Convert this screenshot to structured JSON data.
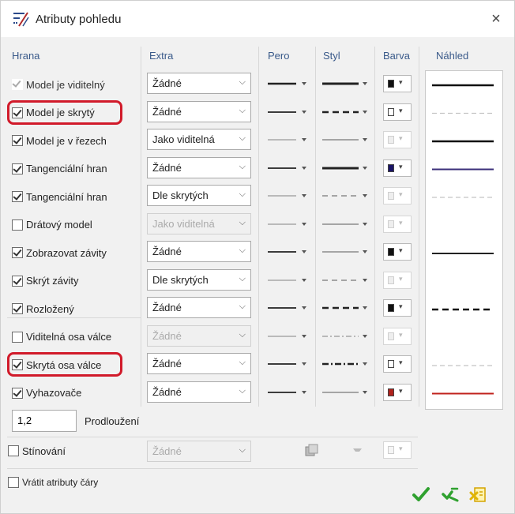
{
  "window": {
    "title": "Atributy pohledu",
    "close": "×"
  },
  "headers": {
    "hrana": "Hrana",
    "extra": "Extra",
    "pero": "Pero",
    "styl": "Styl",
    "barva": "Barva",
    "nahled": "Náhled"
  },
  "rows": [
    {
      "label": "Model je viditelný",
      "checked": true,
      "enabled": false,
      "extra": "Žádné",
      "extra_enabled": true,
      "pen": "thick",
      "style": "solid-thick",
      "color": "#111111",
      "preview": "solid-thick",
      "preview_color": "#111111"
    },
    {
      "label": "Model je skrytý",
      "checked": true,
      "enabled": true,
      "extra": "Žádné",
      "extra_enabled": true,
      "pen": "medium",
      "style": "dashed",
      "color": "#ffffff",
      "preview": "dashed-light",
      "preview_color": "#c4c4c4",
      "highlighted": true
    },
    {
      "label": "Model je v řezech",
      "checked": true,
      "enabled": true,
      "extra": "Jako viditelná",
      "extra_enabled": true,
      "pen": "light",
      "style": "solid-light",
      "color": "#eeeeee",
      "preview": "solid-thick",
      "preview_color": "#111111"
    },
    {
      "label": "Tangenciální hran",
      "checked": true,
      "enabled": true,
      "extra": "Žádné",
      "extra_enabled": true,
      "pen": "medium",
      "style": "solid-thick",
      "color": "#1a1466",
      "preview": "solid-medium",
      "preview_color": "#3b2f7a"
    },
    {
      "label": "Tangenciální hran",
      "checked": true,
      "enabled": true,
      "extra": "Dle skrytých",
      "extra_enabled": true,
      "pen": "light",
      "style": "dashed-light",
      "color": "#eeeeee",
      "preview": "dashed-light",
      "preview_color": "#c4c4c4"
    },
    {
      "label": "Drátový model",
      "checked": false,
      "enabled": true,
      "extra": "Jako viditelná",
      "extra_enabled": false,
      "pen": "light",
      "style": "solid-light",
      "color": "#eeeeee",
      "preview": "none",
      "preview_color": "#ffffff"
    },
    {
      "label": "Zobrazovat závity",
      "checked": true,
      "enabled": true,
      "extra": "Žádné",
      "extra_enabled": true,
      "pen": "medium",
      "style": "solid-light",
      "color": "#111111",
      "preview": "solid-medium",
      "preview_color": "#222222"
    },
    {
      "label": "Skrýt závity",
      "checked": true,
      "enabled": true,
      "extra": "Dle skrytých",
      "extra_enabled": true,
      "pen": "light",
      "style": "dashed-light",
      "color": "#eeeeee",
      "preview": "none",
      "preview_color": "#ffffff"
    },
    {
      "label": "Rozložený",
      "checked": true,
      "enabled": true,
      "extra": "Žádné",
      "extra_enabled": true,
      "pen": "medium",
      "style": "dashed",
      "color": "#111111",
      "preview": "dashed-thick",
      "preview_color": "#111111"
    },
    {
      "label": "Viditelná osa válce",
      "checked": false,
      "enabled": true,
      "extra": "Žádné",
      "extra_enabled": false,
      "pen": "light",
      "style": "dashdot-light",
      "color": "#eeeeee",
      "preview": "none",
      "preview_color": "#ffffff"
    },
    {
      "label": "Skrytá osa válce",
      "checked": true,
      "enabled": true,
      "extra": "Žádné",
      "extra_enabled": true,
      "pen": "medium",
      "style": "dashdot",
      "color": "#ffffff",
      "preview": "dashed-light",
      "preview_color": "#c4c4c4",
      "highlighted": true
    },
    {
      "label": "Vyhazovače",
      "checked": true,
      "enabled": true,
      "extra": "Žádné",
      "extra_enabled": true,
      "pen": "medium",
      "style": "solid-light",
      "color": "#b0221c",
      "preview": "solid-medium",
      "preview_color": "#c0221c"
    }
  ],
  "extension": {
    "value": "1,2",
    "label": "Prodloužení"
  },
  "shading": {
    "label": "Stínování",
    "checked": false,
    "value": "Žádné"
  },
  "reset": {
    "label": "Vrátit atributy čáry",
    "checked": false
  },
  "colors": {
    "accent_red": "#d11a2a",
    "ok_green": "#2fa12f",
    "cancel_yellow": "#e0b400"
  }
}
